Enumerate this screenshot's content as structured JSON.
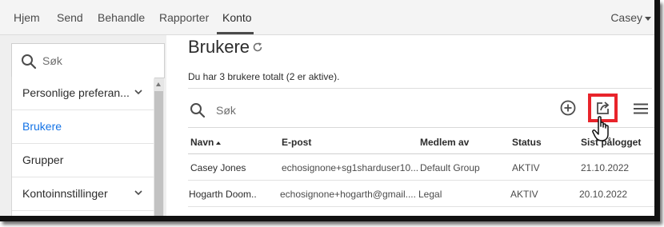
{
  "nav": {
    "items": [
      "Hjem",
      "Send",
      "Behandle",
      "Rapporter",
      "Konto"
    ],
    "active": "Konto",
    "user": "Casey"
  },
  "sidebar": {
    "search_placeholder": "Søk",
    "items": [
      {
        "label": "Personlige preferan...",
        "has_chevron": true
      },
      {
        "label": "Brukere",
        "has_chevron": false,
        "active": true
      },
      {
        "label": "Grupper",
        "has_chevron": false
      },
      {
        "label": "Kontoinnstillinger",
        "has_chevron": true
      }
    ]
  },
  "main": {
    "title": "Brukere",
    "summary": "Du har 3 brukere totalt (2 er aktive).",
    "search_placeholder": "Søk",
    "columns": [
      "Navn",
      "E-post",
      "Medlem av",
      "Status",
      "Sist pålogget"
    ],
    "rows": [
      [
        "Casey Jones",
        "echosignone+sg1sharduser10...",
        "Default Group",
        "AKTIV",
        "21.10.2022"
      ],
      [
        "Hogarth Doom..",
        "echosignone+hogarth@gmail....",
        "Legal",
        "AKTIV",
        "20.10.2022"
      ]
    ]
  },
  "colors": {
    "accent": "#1473e6",
    "highlight": "#e8242b",
    "text": "#2c2c2c"
  },
  "icons": [
    "search-icon",
    "refresh-icon",
    "add-user-icon",
    "export-icon",
    "menu-icon",
    "chevron-down-icon",
    "hand-cursor-icon"
  ]
}
